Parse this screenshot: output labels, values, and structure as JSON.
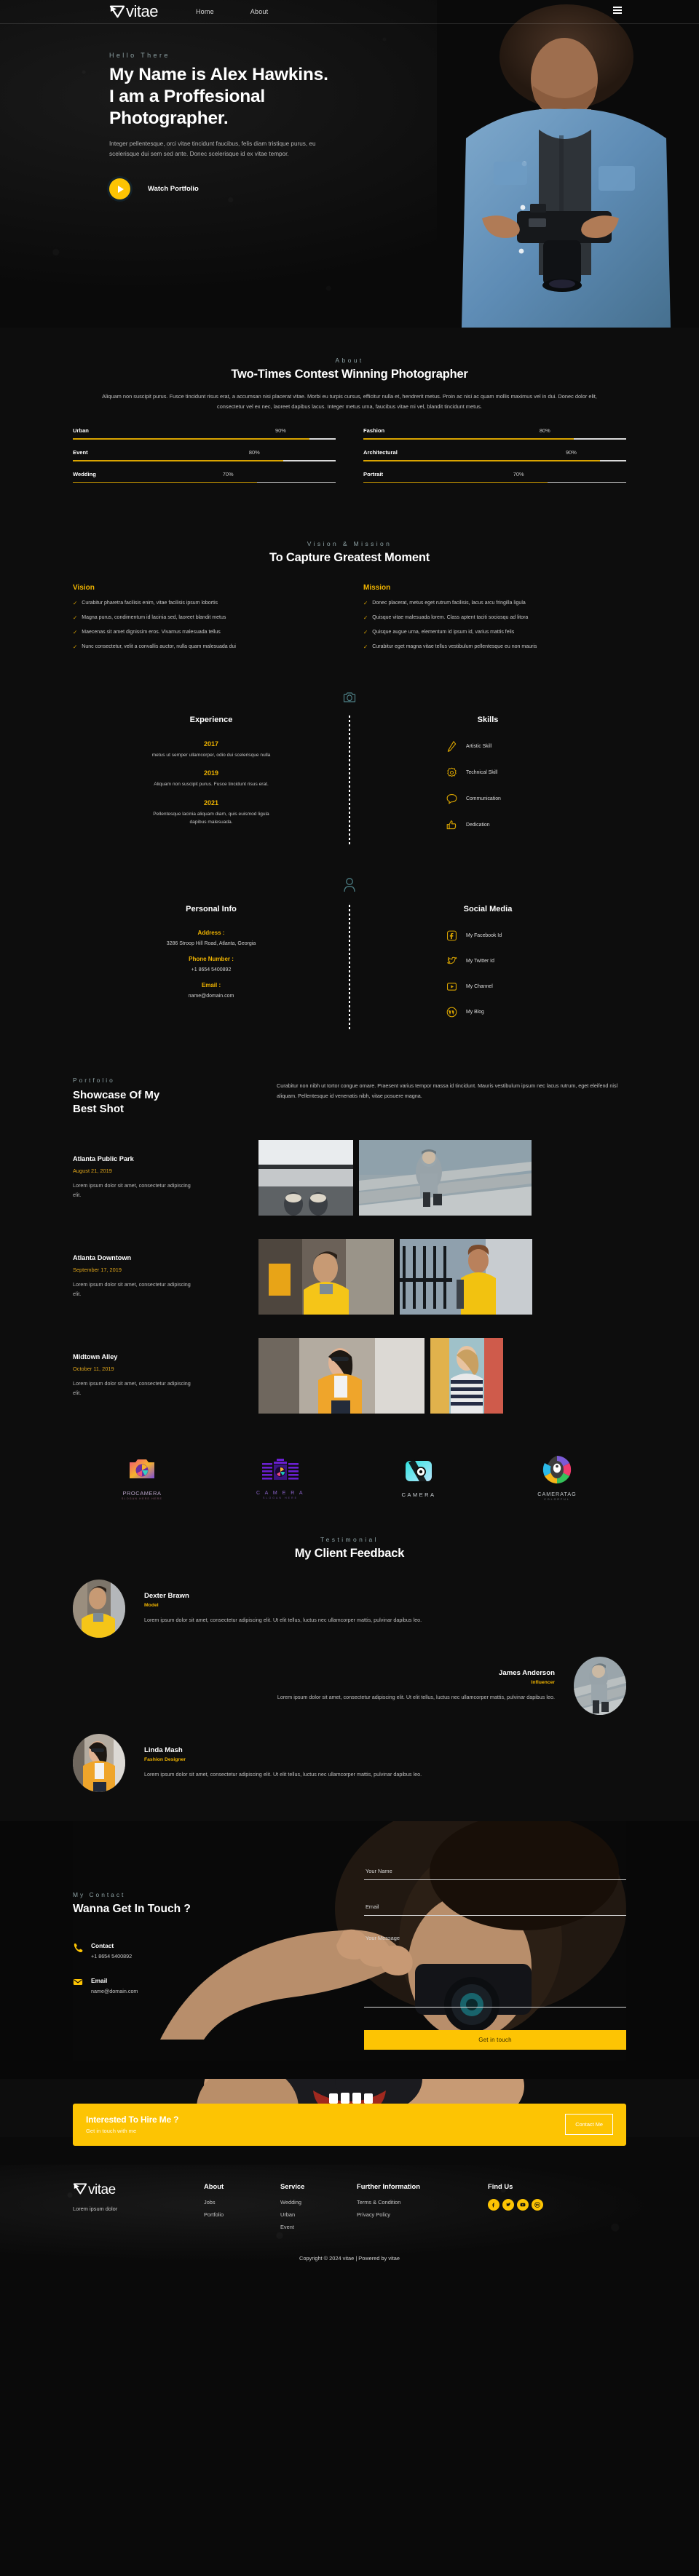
{
  "brand": {
    "name": "vitae",
    "mark": "vitae-logo-mark"
  },
  "nav": {
    "links": [
      "Home",
      "About"
    ],
    "menu_icon": "hamburger-icon"
  },
  "hero": {
    "eyebrow": "Hello There",
    "title_line1": "My Name is Alex Hawkins.",
    "title_line2": "I am a Proffesional",
    "title_line3": "Photographer.",
    "paragraph": "Integer pellentesque, orci vitae tincidunt faucibus, felis diam tristique purus, eu scelerisque dui sem sed ante. Donec scelerisque id ex vitae tempor.",
    "watch_label": "Watch Portfolio",
    "play_icon": "play-icon"
  },
  "about": {
    "eyebrow": "About",
    "title": "Two-Times Contest Winning Photographer",
    "paragraph": "Aliquam non suscipit purus. Fusce tincidunt risus erat, a accumsan nisi placerat vitae. Morbi eu turpis cursus, efficitur nulla et, hendrerit metus. Proin ac nisi ac quam mollis maximus vel in dui. Donec dolor elit, consectetur vel ex nec, laoreet dapibus lacus. Integer metus urna, faucibus vitae mi vel, blandit tincidunt metus.",
    "skills_left": [
      {
        "name": "Urban",
        "pct": 90,
        "pct_label": "90%"
      },
      {
        "name": "Event",
        "pct": 80,
        "pct_label": "80%"
      },
      {
        "name": "Wedding",
        "pct": 70,
        "pct_label": "70%"
      }
    ],
    "skills_right": [
      {
        "name": "Fashion",
        "pct": 80,
        "pct_label": "80%"
      },
      {
        "name": "Architectural",
        "pct": 90,
        "pct_label": "90%"
      },
      {
        "name": "Portrait",
        "pct": 70,
        "pct_label": "70%"
      }
    ]
  },
  "vision": {
    "eyebrow": "Vision & Mission",
    "title": "To Capture Greatest Moment",
    "vision_head": "Vision",
    "mission_head": "Mission",
    "vision_items": [
      "Curabitur pharetra facilisis enim, vitae facilisis ipsum lobortis",
      "Magna purus, condimentum id lacinia sed, laoreet blandit metus",
      "Maecenas sit amet dignissim eros. Vivamus malesuada tellus",
      "Nunc consectetur, velit a convallis auctor, nulla quam malesuada dui"
    ],
    "mission_items": [
      "Donec placerat, metus eget rutrum facilisis, lacus arcu fringilla ligula",
      "Quisque vitae malesuada lorem. Class aptent taciti sociosqu ad litora",
      "Quisque augue urna, elementum id ipsum id, varius mattis felis",
      "Curabitur eget magna vitae tellus vestibulum pellentesque eu non mauris"
    ]
  },
  "experience": {
    "divider_icon": "camera-icon",
    "left_title": "Experience",
    "right_title": "Skills",
    "items": [
      {
        "year": "2017",
        "desc": "metus ut semper ullamcorper, odio dui scelerisque nulla"
      },
      {
        "year": "2019",
        "desc": "Aliquam non suscipit purus. Fusce tincidunt risus erat."
      },
      {
        "year": "2021",
        "desc": "Pellentesque lacinia aliquam diam, quis euismod ligula dapibus malesuada."
      }
    ],
    "skills": [
      {
        "label": "Artistic Skill",
        "icon": "pen-icon"
      },
      {
        "label": "Technical Skill",
        "icon": "gear-icon"
      },
      {
        "label": "Communication",
        "icon": "chat-bubble-icon"
      },
      {
        "label": "Dedication",
        "icon": "thumbs-up-icon"
      }
    ]
  },
  "personal": {
    "divider_icon": "user-icon",
    "left_title": "Personal Info",
    "right_title": "Social Media",
    "info": [
      {
        "label": "Address :",
        "value": "3286 Stroop Hill Road, Atlanta, Georgia"
      },
      {
        "label": "Phone Number :",
        "value": "+1 8654 5400892"
      },
      {
        "label": "Email :",
        "value": "name@domain.com"
      }
    ],
    "social": [
      {
        "label": "My Facebook Id",
        "icon": "facebook-icon"
      },
      {
        "label": "My Twitter Id",
        "icon": "twitter-icon"
      },
      {
        "label": "My Channel",
        "icon": "youtube-icon"
      },
      {
        "label": "My Blog",
        "icon": "wordpress-icon"
      }
    ]
  },
  "portfolio": {
    "eyebrow": "Portfolio",
    "title_line1": "Showcase Of My",
    "title_line2": "Best Shot",
    "description": "Curabitur non nibh ut tortor congue ornare. Praesent varius tempor massa id tincidunt. Mauris vestibulum ipsum nec lacus rutrum, eget eleifend nisl aliquam. Pellentesque id venenatis nibh, vitae posuere magna.",
    "items": [
      {
        "name": "Atlanta Public Park",
        "date": "August 21, 2019",
        "text": "Lorem ipsum dolor sit amet, consectetur adipiscing elit."
      },
      {
        "name": "Atlanta Downtown",
        "date": "September 17, 2019",
        "text": "Lorem ipsum dolor sit amet, consectetur adipiscing elit."
      },
      {
        "name": "MIdtown Alley",
        "date": "October 11, 2019",
        "text": "Lorem ipsum dolor sit amet, consectetur adipiscing elit."
      }
    ]
  },
  "brands": [
    {
      "name": "PROCAMERA",
      "sub": "SLOGAN HERE HERE"
    },
    {
      "name": "C A M E R A",
      "sub": "SLOGAN HERE"
    },
    {
      "name": "CAMERA",
      "sub": ""
    },
    {
      "name": "CAMERATAG",
      "sub": "COLORFUL"
    }
  ],
  "testimonial": {
    "eyebrow": "Testimonial",
    "title": "My Client Feedback",
    "items": [
      {
        "name": "Dexter Brawn",
        "role": "Model",
        "text": "Lorem ipsum dolor sit amet, consectetur adipiscing elit. Ut elit tellus, luctus nec ullamcorper mattis, pulvinar dapibus leo.",
        "align": "left"
      },
      {
        "name": "James Anderson",
        "role": "Influencer",
        "text": "Lorem ipsum dolor sit amet, consectetur adipiscing elit. Ut elit tellus, luctus nec ullamcorper mattis, pulvinar dapibus leo.",
        "align": "right"
      },
      {
        "name": "Linda Mash",
        "role": "Fashion Designer",
        "text": "Lorem ipsum dolor sit amet, consectetur adipiscing elit. Ut elit tellus, luctus nec ullamcorper mattis, pulvinar dapibus leo.",
        "align": "left"
      }
    ]
  },
  "contact": {
    "eyebrow": "My Contact",
    "title": "Wanna Get In Touch ?",
    "phone_label": "Contact",
    "phone_value": "+1 8654 5400892",
    "phone_icon": "phone-icon",
    "email_label": "Email",
    "email_value": "name@domain.com",
    "email_icon": "envelope-icon",
    "form": {
      "name_placeholder": "Your Name",
      "name_value": "",
      "email_placeholder": "Email",
      "email_value": "",
      "message_placeholder": "Your Message",
      "message_value": "",
      "submit_label": "Get in touch"
    }
  },
  "cta": {
    "title": "Interested To Hire Me ?",
    "subtitle": "Get in touch with me",
    "button_label": "Contact Me"
  },
  "footer": {
    "tagline": "Lorem ipsum dolor",
    "columns": [
      {
        "head": "About",
        "links": [
          "Jobs",
          "Portfolio"
        ]
      },
      {
        "head": "Service",
        "links": [
          "Wedding",
          "Urban",
          "Event"
        ]
      },
      {
        "head": "Further Information",
        "links": [
          "Terms & Condition",
          "Privacy Policy"
        ]
      }
    ],
    "find_us_head": "Find Us",
    "socials": [
      "facebook-icon",
      "twitter-icon",
      "youtube-icon",
      "wordpress-icon"
    ],
    "copyright": "Copyright © 2024 vitae | Powered by vitae"
  },
  "colors": {
    "accent": "#fdc403",
    "accent_dark": "#d9a400",
    "eyebrow": "#8fa3a6",
    "bg": "#0d0d0d"
  }
}
